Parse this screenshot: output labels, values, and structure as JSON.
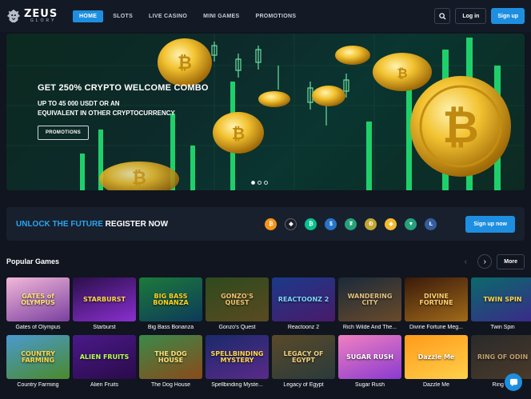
{
  "header": {
    "logo_main": "ZEUS",
    "logo_sub": "GLORY",
    "nav": [
      "HOME",
      "SLOTS",
      "LIVE CASINO",
      "MINI GAMES",
      "PROMOTIONS"
    ],
    "login": "Log in",
    "signup": "Sign up"
  },
  "hero": {
    "title": "GET 250% CRYPTO WELCOME COMBO",
    "subtitle_line1": "UP TO 45 000 USDT OR AN",
    "subtitle_line2": "EQUIVALENT IN OTHER CRYPTOCURRENCY",
    "button": "PROMOTIONS",
    "slides_total": 3,
    "slide_active": 1
  },
  "register": {
    "title_highlight": "UNLOCK THE FUTURE",
    "title_rest": "REGISTER NOW",
    "button": "Sign up now",
    "coins": [
      {
        "icon": "bitcoin-icon",
        "glyph": "₿",
        "color": "#f7931a"
      },
      {
        "icon": "ethereum-icon",
        "glyph": "◆",
        "color": "#1b1f2a"
      },
      {
        "icon": "bitcoin-cash-icon",
        "glyph": "₿",
        "color": "#0ac18e"
      },
      {
        "icon": "usdc-icon",
        "glyph": "$",
        "color": "#2775ca"
      },
      {
        "icon": "tether-icon",
        "glyph": "₮",
        "color": "#26a17b"
      },
      {
        "icon": "dogecoin-icon",
        "glyph": "Ð",
        "color": "#c2a633"
      },
      {
        "icon": "bnb-icon",
        "glyph": "◈",
        "color": "#f3ba2f"
      },
      {
        "icon": "tron-icon",
        "glyph": "▼",
        "color": "#26a17b"
      },
      {
        "icon": "litecoin-icon",
        "glyph": "Ł",
        "color": "#345d9d"
      }
    ]
  },
  "popular": {
    "title": "Popular Games",
    "more": "More",
    "games": [
      {
        "name": "Gates of Olympus",
        "art": "GATES of OLYMPUS",
        "c1": "#f2b8d8",
        "c2": "#7a3fa0",
        "fg": "#ffe27a"
      },
      {
        "name": "Starburst",
        "art": "STARBURST",
        "c1": "#2a0f4a",
        "c2": "#8a2fd0",
        "fg": "#ffd84a"
      },
      {
        "name": "Big Bass Bonanza",
        "art": "BIG BASS BONANZA",
        "c1": "#1c7a3a",
        "c2": "#0d3a5a",
        "fg": "#ffd21e"
      },
      {
        "name": "Gonzo's Quest",
        "art": "GONZO'S QUEST",
        "c1": "#2e4a1e",
        "c2": "#5a4a20",
        "fg": "#f0c070"
      },
      {
        "name": "Reactoonz 2",
        "art": "REACTOONZ 2",
        "c1": "#1b3a8a",
        "c2": "#4a1a6a",
        "fg": "#7ad8ff"
      },
      {
        "name": "Rich Wilde And The...",
        "art": "WANDERING CITY",
        "c1": "#1a2a3a",
        "c2": "#6a4a2a",
        "fg": "#e0c080"
      },
      {
        "name": "Divine Fortune Meg...",
        "art": "DIVINE FORTUNE",
        "c1": "#3a1a0a",
        "c2": "#a06a1a",
        "fg": "#ffd070"
      },
      {
        "name": "Twin Spin",
        "art": "TWIN SPIN",
        "c1": "#0a6a6a",
        "c2": "#3a2a8a",
        "fg": "#ffd84a"
      },
      {
        "name": "Country Farming",
        "art": "COUNTRY FARMING",
        "c1": "#4a9ad0",
        "c2": "#4a8a2a",
        "fg": "#ffd84a"
      },
      {
        "name": "Alien Fruits",
        "art": "ALIEN FRUITS",
        "c1": "#4a1a8a",
        "c2": "#2a0a4a",
        "fg": "#b8ff5a"
      },
      {
        "name": "The Dog House",
        "art": "THE DOG HOUSE",
        "c1": "#3a8a4a",
        "c2": "#8a4a1a",
        "fg": "#ffe27a"
      },
      {
        "name": "Spellbinding Myste...",
        "art": "SPELLBINDING MYSTERY",
        "c1": "#1a2a6a",
        "c2": "#5a2a8a",
        "fg": "#ffd84a"
      },
      {
        "name": "Legacy of Egypt",
        "art": "LEGACY OF EGYPT",
        "c1": "#5a4a2a",
        "c2": "#2a3a3a",
        "fg": "#f0d080"
      },
      {
        "name": "Sugar Rush",
        "art": "SUGAR RUSH",
        "c1": "#f080c0",
        "c2": "#8a3ad0",
        "fg": "#ffffff"
      },
      {
        "name": "Dazzle Me",
        "art": "Dazzle Me",
        "c1": "#ff9a1a",
        "c2": "#ffd04a",
        "fg": "#ffffff"
      },
      {
        "name": "Ring o...",
        "art": "RING OF ODIN",
        "c1": "#2a2a2a",
        "c2": "#4a3a2a",
        "fg": "#c0a070"
      }
    ]
  }
}
